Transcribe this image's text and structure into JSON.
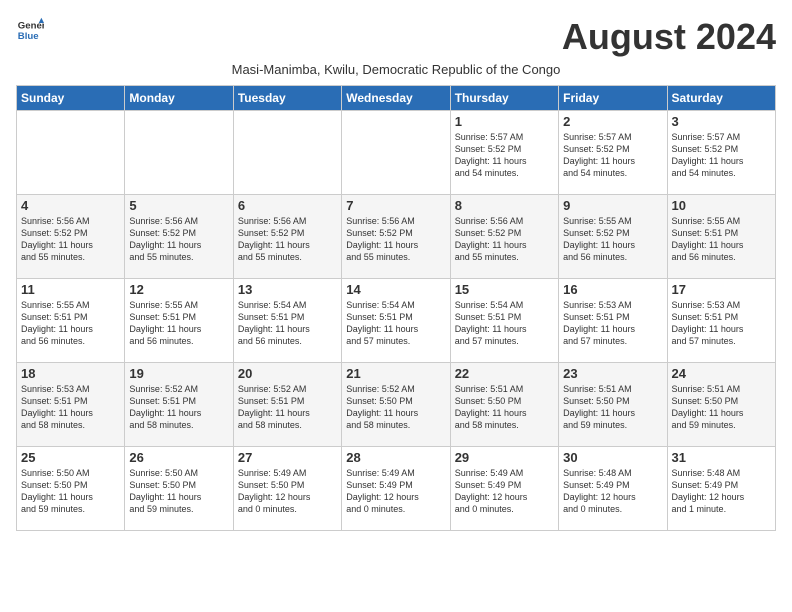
{
  "logo": {
    "general": "General",
    "blue": "Blue"
  },
  "title": "August 2024",
  "subtitle": "Masi-Manimba, Kwilu, Democratic Republic of the Congo",
  "days_of_week": [
    "Sunday",
    "Monday",
    "Tuesday",
    "Wednesday",
    "Thursday",
    "Friday",
    "Saturday"
  ],
  "weeks": [
    [
      {
        "day": "",
        "info": ""
      },
      {
        "day": "",
        "info": ""
      },
      {
        "day": "",
        "info": ""
      },
      {
        "day": "",
        "info": ""
      },
      {
        "day": "1",
        "info": "Sunrise: 5:57 AM\nSunset: 5:52 PM\nDaylight: 11 hours\nand 54 minutes."
      },
      {
        "day": "2",
        "info": "Sunrise: 5:57 AM\nSunset: 5:52 PM\nDaylight: 11 hours\nand 54 minutes."
      },
      {
        "day": "3",
        "info": "Sunrise: 5:57 AM\nSunset: 5:52 PM\nDaylight: 11 hours\nand 54 minutes."
      }
    ],
    [
      {
        "day": "4",
        "info": "Sunrise: 5:56 AM\nSunset: 5:52 PM\nDaylight: 11 hours\nand 55 minutes."
      },
      {
        "day": "5",
        "info": "Sunrise: 5:56 AM\nSunset: 5:52 PM\nDaylight: 11 hours\nand 55 minutes."
      },
      {
        "day": "6",
        "info": "Sunrise: 5:56 AM\nSunset: 5:52 PM\nDaylight: 11 hours\nand 55 minutes."
      },
      {
        "day": "7",
        "info": "Sunrise: 5:56 AM\nSunset: 5:52 PM\nDaylight: 11 hours\nand 55 minutes."
      },
      {
        "day": "8",
        "info": "Sunrise: 5:56 AM\nSunset: 5:52 PM\nDaylight: 11 hours\nand 55 minutes."
      },
      {
        "day": "9",
        "info": "Sunrise: 5:55 AM\nSunset: 5:52 PM\nDaylight: 11 hours\nand 56 minutes."
      },
      {
        "day": "10",
        "info": "Sunrise: 5:55 AM\nSunset: 5:51 PM\nDaylight: 11 hours\nand 56 minutes."
      }
    ],
    [
      {
        "day": "11",
        "info": "Sunrise: 5:55 AM\nSunset: 5:51 PM\nDaylight: 11 hours\nand 56 minutes."
      },
      {
        "day": "12",
        "info": "Sunrise: 5:55 AM\nSunset: 5:51 PM\nDaylight: 11 hours\nand 56 minutes."
      },
      {
        "day": "13",
        "info": "Sunrise: 5:54 AM\nSunset: 5:51 PM\nDaylight: 11 hours\nand 56 minutes."
      },
      {
        "day": "14",
        "info": "Sunrise: 5:54 AM\nSunset: 5:51 PM\nDaylight: 11 hours\nand 57 minutes."
      },
      {
        "day": "15",
        "info": "Sunrise: 5:54 AM\nSunset: 5:51 PM\nDaylight: 11 hours\nand 57 minutes."
      },
      {
        "day": "16",
        "info": "Sunrise: 5:53 AM\nSunset: 5:51 PM\nDaylight: 11 hours\nand 57 minutes."
      },
      {
        "day": "17",
        "info": "Sunrise: 5:53 AM\nSunset: 5:51 PM\nDaylight: 11 hours\nand 57 minutes."
      }
    ],
    [
      {
        "day": "18",
        "info": "Sunrise: 5:53 AM\nSunset: 5:51 PM\nDaylight: 11 hours\nand 58 minutes."
      },
      {
        "day": "19",
        "info": "Sunrise: 5:52 AM\nSunset: 5:51 PM\nDaylight: 11 hours\nand 58 minutes."
      },
      {
        "day": "20",
        "info": "Sunrise: 5:52 AM\nSunset: 5:51 PM\nDaylight: 11 hours\nand 58 minutes."
      },
      {
        "day": "21",
        "info": "Sunrise: 5:52 AM\nSunset: 5:50 PM\nDaylight: 11 hours\nand 58 minutes."
      },
      {
        "day": "22",
        "info": "Sunrise: 5:51 AM\nSunset: 5:50 PM\nDaylight: 11 hours\nand 58 minutes."
      },
      {
        "day": "23",
        "info": "Sunrise: 5:51 AM\nSunset: 5:50 PM\nDaylight: 11 hours\nand 59 minutes."
      },
      {
        "day": "24",
        "info": "Sunrise: 5:51 AM\nSunset: 5:50 PM\nDaylight: 11 hours\nand 59 minutes."
      }
    ],
    [
      {
        "day": "25",
        "info": "Sunrise: 5:50 AM\nSunset: 5:50 PM\nDaylight: 11 hours\nand 59 minutes."
      },
      {
        "day": "26",
        "info": "Sunrise: 5:50 AM\nSunset: 5:50 PM\nDaylight: 11 hours\nand 59 minutes."
      },
      {
        "day": "27",
        "info": "Sunrise: 5:49 AM\nSunset: 5:50 PM\nDaylight: 12 hours\nand 0 minutes."
      },
      {
        "day": "28",
        "info": "Sunrise: 5:49 AM\nSunset: 5:49 PM\nDaylight: 12 hours\nand 0 minutes."
      },
      {
        "day": "29",
        "info": "Sunrise: 5:49 AM\nSunset: 5:49 PM\nDaylight: 12 hours\nand 0 minutes."
      },
      {
        "day": "30",
        "info": "Sunrise: 5:48 AM\nSunset: 5:49 PM\nDaylight: 12 hours\nand 0 minutes."
      },
      {
        "day": "31",
        "info": "Sunrise: 5:48 AM\nSunset: 5:49 PM\nDaylight: 12 hours\nand 1 minute."
      }
    ]
  ]
}
